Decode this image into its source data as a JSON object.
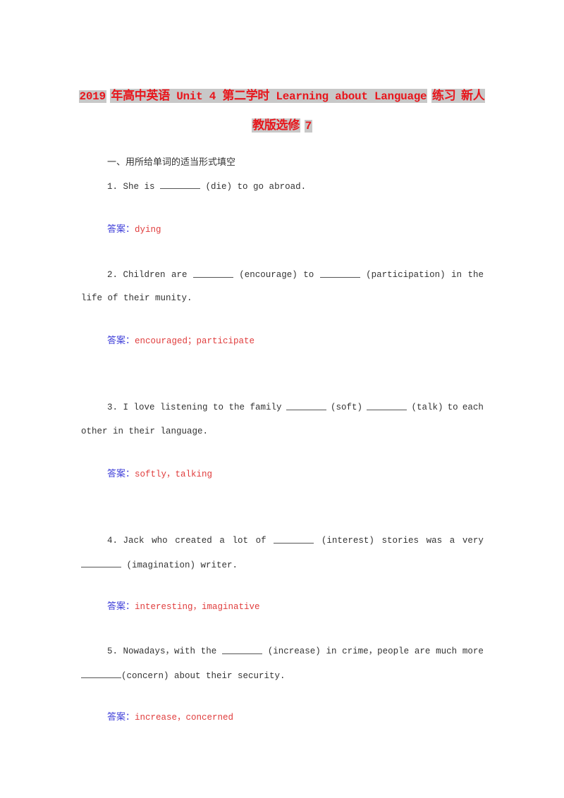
{
  "document": {
    "title": {
      "line1": {
        "year": "2019",
        "prefix": "年高中英语",
        "unit": " Unit 4 ",
        "lesson": "第二学时",
        "topic": " Learning about Language",
        "suffix": "练习",
        "publisher_part": " 新人"
      },
      "line2": {
        "edition": "教版选修",
        "number": "7"
      }
    },
    "section_heading": "一、用所给单词的适当形式填空",
    "answer_label": "答案：",
    "questions": [
      {
        "number": "1.",
        "line1_parts": [
          "1. She is",
          "(die) to go abroad."
        ],
        "answer": "dying"
      },
      {
        "number": "2.",
        "line1_parts": [
          "2. Children",
          "are",
          "(encourage)",
          "to",
          "(participation)",
          "in",
          "the"
        ],
        "line2": "life of their munity.",
        "answer": "encouraged；participate"
      },
      {
        "number": "3.",
        "line1_parts": [
          "3. I love listening to the family",
          "(soft)",
          "(talk)",
          "to",
          "each"
        ],
        "line2": "other in their language.",
        "answer": "softly，talking"
      },
      {
        "number": "4.",
        "line1_parts": [
          "4. Jack",
          "who",
          "created",
          "a",
          "lot",
          "of",
          "(interest)",
          "stories",
          "was",
          "a",
          "very"
        ],
        "line2": "(imagination) writer.",
        "answer": "interesting，imaginative"
      },
      {
        "number": "5.",
        "line1_parts": [
          "5. Nowadays，with",
          "the",
          "(increase)",
          "in",
          "crime，people",
          "are",
          "much",
          "more"
        ],
        "line2": "(concern) about their security.",
        "answer": "increase，concerned"
      }
    ]
  },
  "colors": {
    "title_text": "#e8161c",
    "title_highlight": "#c8c8c8",
    "answer_label": "#3c3cd8",
    "answer_text": "#e03c3c",
    "body_text": "#333333"
  }
}
